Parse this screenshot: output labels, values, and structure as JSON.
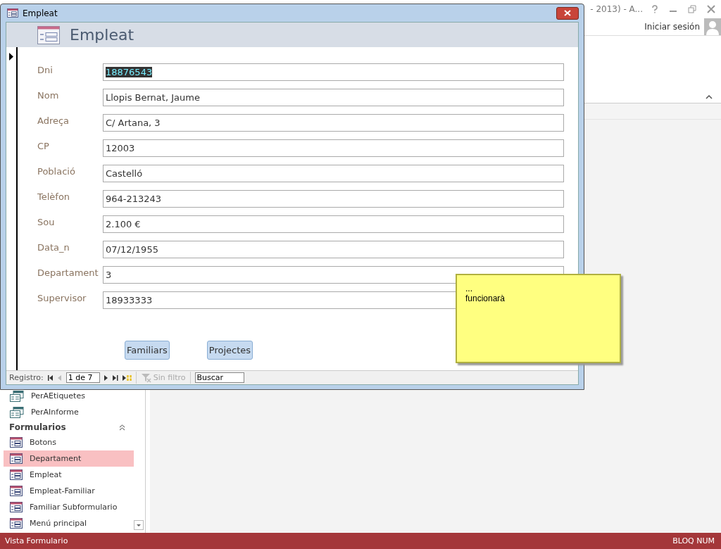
{
  "app": {
    "title": "- 2013) - A...",
    "signin": "Iniciar sesión"
  },
  "nav_pane": {
    "items": [
      {
        "label": "PerAEtiquetes",
        "kind": "report",
        "selected": false
      },
      {
        "label": "PerAInforme",
        "kind": "report",
        "selected": false
      },
      {
        "label": "Formularios",
        "kind": "section"
      },
      {
        "label": "Botons",
        "kind": "form",
        "selected": false
      },
      {
        "label": "Departament",
        "kind": "form",
        "selected": true
      },
      {
        "label": "Empleat",
        "kind": "form",
        "selected": false
      },
      {
        "label": "Empleat-Familiar",
        "kind": "form",
        "selected": false
      },
      {
        "label": "Familiar Subformulario",
        "kind": "form",
        "selected": false
      },
      {
        "label": "Menú principal",
        "kind": "form",
        "selected": false
      }
    ]
  },
  "form_window": {
    "title": "Empleat",
    "header": "Empleat",
    "fields": [
      {
        "label": "Dni",
        "value": "18876543",
        "highlighted": true
      },
      {
        "label": "Nom",
        "value": "Llopis Bernat, Jaume",
        "highlighted": false
      },
      {
        "label": "Adreça",
        "value": "C/ Artana, 3",
        "highlighted": false
      },
      {
        "label": "CP",
        "value": "12003",
        "highlighted": false
      },
      {
        "label": "Població",
        "value": "Castelló",
        "highlighted": false
      },
      {
        "label": "Telèfon",
        "value": "964-213243",
        "highlighted": false
      },
      {
        "label": "Sou",
        "value": "2.100 €",
        "highlighted": false
      },
      {
        "label": "Data_n",
        "value": "07/12/1955",
        "highlighted": false
      },
      {
        "label": "Departament",
        "value": "3",
        "highlighted": false
      },
      {
        "label": "Supervisor",
        "value": "18933333",
        "highlighted": false
      }
    ],
    "buttons": [
      "Familiars",
      "Projectes"
    ],
    "navigation": {
      "label": "Registro:",
      "position": "1 de 7",
      "filter": {
        "label": "Sin filtro",
        "disabled": true
      },
      "search": {
        "placeholder": "Buscar"
      }
    }
  },
  "note": {
    "lines": [
      "...",
      "funcionarà"
    ]
  },
  "status_bar": {
    "left": "Vista Formulario",
    "right": "BLOQ NUM"
  }
}
